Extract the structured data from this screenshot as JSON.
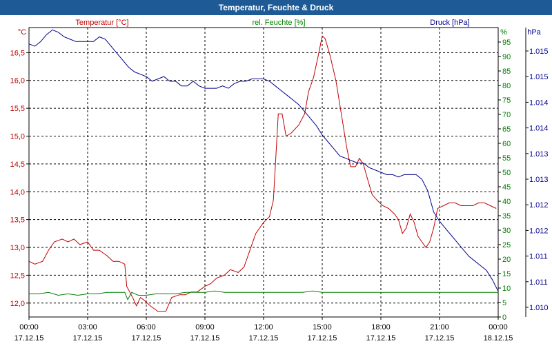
{
  "window_title": "Temperatur, Feuchte & Druck",
  "chart_data": {
    "type": "line",
    "title": "Temperatur, Feuchte & Druck",
    "colors": {
      "temperature": "#c00000",
      "humidity": "#008000",
      "pressure": "#00008b"
    },
    "grid": true,
    "x_ticks": [
      {
        "time": "00:00",
        "date": "17.12.15"
      },
      {
        "time": "03:00",
        "date": "17.12.15"
      },
      {
        "time": "06:00",
        "date": "17.12.15"
      },
      {
        "time": "09:00",
        "date": "17.12.15"
      },
      {
        "time": "12:00",
        "date": "17.12.15"
      },
      {
        "time": "15:00",
        "date": "17.12.15"
      },
      {
        "time": "18:00",
        "date": "17.12.15"
      },
      {
        "time": "21:00",
        "date": "17.12.15"
      },
      {
        "time": "00:00",
        "date": "18.12.15"
      }
    ],
    "xlim_hours": [
      0,
      24
    ],
    "axes": {
      "temperature": {
        "unit": "°C",
        "ylim": [
          11.75,
          16.95
        ],
        "ticks": [
          "12,0",
          "12,5",
          "13,0",
          "13,5",
          "14,0",
          "14,5",
          "15,0",
          "15,5",
          "16,0",
          "16,5"
        ]
      },
      "humidity": {
        "unit": "%",
        "ylim": [
          0,
          100
        ],
        "ticks": [
          "0",
          "5",
          "10",
          "15",
          "20",
          "25",
          "30",
          "35",
          "40",
          "45",
          "50",
          "55",
          "60",
          "65",
          "70",
          "75",
          "80",
          "85",
          "90",
          "95"
        ]
      },
      "pressure": {
        "unit": "hPa",
        "ylim": [
          1009.4,
          1015.6
        ],
        "ticks": [
          "1.010",
          "1.011",
          "1.011",
          "1.012",
          "1.012",
          "1.013",
          "1.013",
          "1.014",
          "1.014",
          "1.015",
          "1.015"
        ]
      }
    },
    "series": [
      {
        "name": "Temperatur [°C]",
        "axis": "temperature",
        "points": [
          [
            0,
            12.75
          ],
          [
            0.3,
            12.7
          ],
          [
            0.7,
            12.75
          ],
          [
            1,
            12.95
          ],
          [
            1.3,
            13.1
          ],
          [
            1.7,
            13.15
          ],
          [
            2,
            13.1
          ],
          [
            2.3,
            13.15
          ],
          [
            2.6,
            13.05
          ],
          [
            3,
            13.1
          ],
          [
            3.3,
            12.95
          ],
          [
            3.6,
            12.95
          ],
          [
            4,
            12.85
          ],
          [
            4.3,
            12.75
          ],
          [
            4.6,
            12.75
          ],
          [
            4.9,
            12.7
          ],
          [
            5,
            12.3
          ],
          [
            5.3,
            12.1
          ],
          [
            5.5,
            11.95
          ],
          [
            5.7,
            12.1
          ],
          [
            5.9,
            12.05
          ],
          [
            6.2,
            11.95
          ],
          [
            6.6,
            11.85
          ],
          [
            7,
            11.85
          ],
          [
            7.3,
            12.1
          ],
          [
            7.7,
            12.15
          ],
          [
            8,
            12.15
          ],
          [
            8.3,
            12.2
          ],
          [
            8.6,
            12.2
          ],
          [
            9,
            12.3
          ],
          [
            9.3,
            12.35
          ],
          [
            9.6,
            12.45
          ],
          [
            10,
            12.5
          ],
          [
            10.3,
            12.6
          ],
          [
            10.7,
            12.55
          ],
          [
            11,
            12.65
          ],
          [
            11.3,
            12.95
          ],
          [
            11.6,
            13.25
          ],
          [
            12,
            13.45
          ],
          [
            12.3,
            13.55
          ],
          [
            12.5,
            13.85
          ],
          [
            12.75,
            15.4
          ],
          [
            12.95,
            15.4
          ],
          [
            13.15,
            15.0
          ],
          [
            13.4,
            15.05
          ],
          [
            13.8,
            15.2
          ],
          [
            14.1,
            15.4
          ],
          [
            14.3,
            15.8
          ],
          [
            14.55,
            16.05
          ],
          [
            14.8,
            16.45
          ],
          [
            15.0,
            16.8
          ],
          [
            15.15,
            16.75
          ],
          [
            15.4,
            16.45
          ],
          [
            15.7,
            16.0
          ],
          [
            16.0,
            15.35
          ],
          [
            16.25,
            14.8
          ],
          [
            16.45,
            14.45
          ],
          [
            16.7,
            14.45
          ],
          [
            16.9,
            14.6
          ],
          [
            17.1,
            14.5
          ],
          [
            17.3,
            14.25
          ],
          [
            17.55,
            13.95
          ],
          [
            17.8,
            13.85
          ],
          [
            18.1,
            13.75
          ],
          [
            18.4,
            13.7
          ],
          [
            18.7,
            13.6
          ],
          [
            18.9,
            13.5
          ],
          [
            19.1,
            13.25
          ],
          [
            19.3,
            13.35
          ],
          [
            19.5,
            13.6
          ],
          [
            19.7,
            13.45
          ],
          [
            19.9,
            13.2
          ],
          [
            20.1,
            13.1
          ],
          [
            20.3,
            13.0
          ],
          [
            20.5,
            13.1
          ],
          [
            20.7,
            13.35
          ],
          [
            20.9,
            13.7
          ],
          [
            21.2,
            13.75
          ],
          [
            21.5,
            13.8
          ],
          [
            21.8,
            13.8
          ],
          [
            22.1,
            13.75
          ],
          [
            22.4,
            13.75
          ],
          [
            22.7,
            13.75
          ],
          [
            23.0,
            13.8
          ],
          [
            23.3,
            13.8
          ],
          [
            23.6,
            13.75
          ],
          [
            23.9,
            13.7
          ]
        ]
      },
      {
        "name": "rel. Feuchte [%]",
        "axis": "humidity",
        "points": [
          [
            0,
            8
          ],
          [
            0.5,
            8
          ],
          [
            1,
            8.5
          ],
          [
            1.5,
            7.5
          ],
          [
            2,
            8
          ],
          [
            2.5,
            7.5
          ],
          [
            3,
            8
          ],
          [
            3.5,
            8
          ],
          [
            4,
            8.5
          ],
          [
            4.5,
            8.5
          ],
          [
            4.9,
            8.5
          ],
          [
            5.05,
            6
          ],
          [
            5.25,
            8.5
          ],
          [
            5.6,
            7.5
          ],
          [
            6,
            7.5
          ],
          [
            6.5,
            8
          ],
          [
            7,
            8
          ],
          [
            7.5,
            8
          ],
          [
            8,
            8.5
          ],
          [
            9,
            8.5
          ],
          [
            9.5,
            9
          ],
          [
            10,
            8.5
          ],
          [
            11,
            8.5
          ],
          [
            12,
            8.5
          ],
          [
            13,
            8.5
          ],
          [
            14,
            8.5
          ],
          [
            14.5,
            9
          ],
          [
            15,
            8.5
          ],
          [
            16,
            8.5
          ],
          [
            17,
            8.5
          ],
          [
            18,
            8.5
          ],
          [
            19,
            8.5
          ],
          [
            20,
            8.5
          ],
          [
            21,
            8.5
          ],
          [
            22,
            8.5
          ],
          [
            23,
            8.5
          ],
          [
            24,
            8.5
          ]
        ]
      },
      {
        "name": "Druck [hPa]",
        "axis": "pressure",
        "points": [
          [
            0,
            1015.25
          ],
          [
            0.3,
            1015.2
          ],
          [
            0.6,
            1015.3
          ],
          [
            0.9,
            1015.45
          ],
          [
            1.2,
            1015.55
          ],
          [
            1.5,
            1015.5
          ],
          [
            1.8,
            1015.4
          ],
          [
            2.1,
            1015.35
          ],
          [
            2.4,
            1015.3
          ],
          [
            2.7,
            1015.3
          ],
          [
            3.0,
            1015.3
          ],
          [
            3.3,
            1015.3
          ],
          [
            3.6,
            1015.4
          ],
          [
            3.9,
            1015.35
          ],
          [
            4.2,
            1015.2
          ],
          [
            4.5,
            1015.05
          ],
          [
            4.8,
            1014.9
          ],
          [
            5.1,
            1014.75
          ],
          [
            5.4,
            1014.65
          ],
          [
            5.7,
            1014.6
          ],
          [
            6.0,
            1014.55
          ],
          [
            6.3,
            1014.45
          ],
          [
            6.6,
            1014.5
          ],
          [
            6.9,
            1014.55
          ],
          [
            7.2,
            1014.45
          ],
          [
            7.5,
            1014.45
          ],
          [
            7.8,
            1014.35
          ],
          [
            8.1,
            1014.35
          ],
          [
            8.4,
            1014.45
          ],
          [
            8.7,
            1014.35
          ],
          [
            9.0,
            1014.3
          ],
          [
            9.3,
            1014.3
          ],
          [
            9.6,
            1014.3
          ],
          [
            9.9,
            1014.35
          ],
          [
            10.2,
            1014.3
          ],
          [
            10.5,
            1014.4
          ],
          [
            10.8,
            1014.45
          ],
          [
            11.1,
            1014.45
          ],
          [
            11.4,
            1014.5
          ],
          [
            11.7,
            1014.5
          ],
          [
            12.0,
            1014.5
          ],
          [
            12.3,
            1014.45
          ],
          [
            12.6,
            1014.35
          ],
          [
            12.9,
            1014.25
          ],
          [
            13.2,
            1014.15
          ],
          [
            13.5,
            1014.05
          ],
          [
            13.8,
            1013.95
          ],
          [
            14.1,
            1013.8
          ],
          [
            14.4,
            1013.65
          ],
          [
            14.7,
            1013.5
          ],
          [
            15.0,
            1013.3
          ],
          [
            15.3,
            1013.15
          ],
          [
            15.6,
            1013.0
          ],
          [
            15.9,
            1012.85
          ],
          [
            16.2,
            1012.8
          ],
          [
            16.5,
            1012.75
          ],
          [
            16.8,
            1012.7
          ],
          [
            17.1,
            1012.7
          ],
          [
            17.4,
            1012.6
          ],
          [
            17.7,
            1012.55
          ],
          [
            18.0,
            1012.5
          ],
          [
            18.3,
            1012.45
          ],
          [
            18.6,
            1012.45
          ],
          [
            18.9,
            1012.4
          ],
          [
            19.2,
            1012.45
          ],
          [
            19.5,
            1012.45
          ],
          [
            19.8,
            1012.45
          ],
          [
            20.1,
            1012.35
          ],
          [
            20.4,
            1012.1
          ],
          [
            20.7,
            1011.65
          ],
          [
            21.0,
            1011.45
          ],
          [
            21.3,
            1011.3
          ],
          [
            21.6,
            1011.15
          ],
          [
            21.9,
            1011.0
          ],
          [
            22.2,
            1010.85
          ],
          [
            22.5,
            1010.7
          ],
          [
            22.8,
            1010.6
          ],
          [
            23.1,
            1010.5
          ],
          [
            23.4,
            1010.4
          ],
          [
            23.7,
            1010.2
          ],
          [
            24.0,
            1009.95
          ]
        ]
      }
    ],
    "legend": {
      "temperature": "Temperatur [°C]",
      "humidity": "rel. Feuchte [%]",
      "pressure": "Druck [hPa]"
    }
  }
}
